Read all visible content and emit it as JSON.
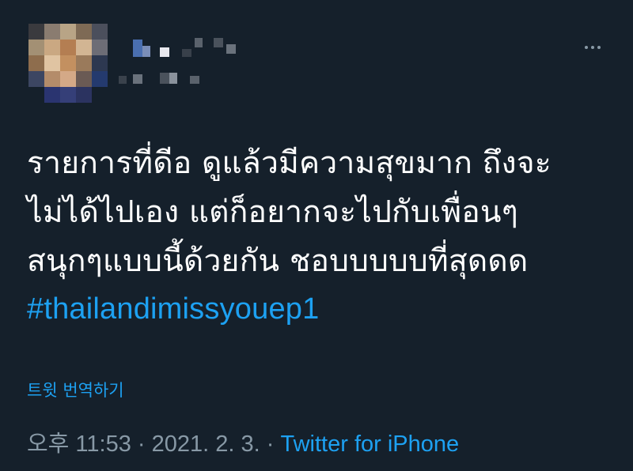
{
  "tweet": {
    "text_lines": [
      "รายการที่ดีอ ดูแล้วมีความสุขมาก ถึงจะ",
      "ไม่ได้ไปเอง แต่ก็อยากจะไปกับเพื่อนๆ",
      "สนุกๆแบบนี้ด้วยกัน ชอบบบบบที่สุดดด"
    ],
    "hashtag": "#thailandimissyouep1",
    "translate_label": "트윗 번역하기",
    "time": "오후 11:53",
    "separator": "·",
    "date": "2021. 2. 3.",
    "source": "Twitter for iPhone"
  },
  "author": {
    "avatar_icon": "blurred-avatar",
    "name_icon": "blurred-display-name"
  },
  "colors": {
    "background": "#15202b",
    "text": "#ffffff",
    "accent": "#1da1f2",
    "muted": "#8899a6"
  },
  "icons": {
    "more": "more-horizontal-icon"
  }
}
